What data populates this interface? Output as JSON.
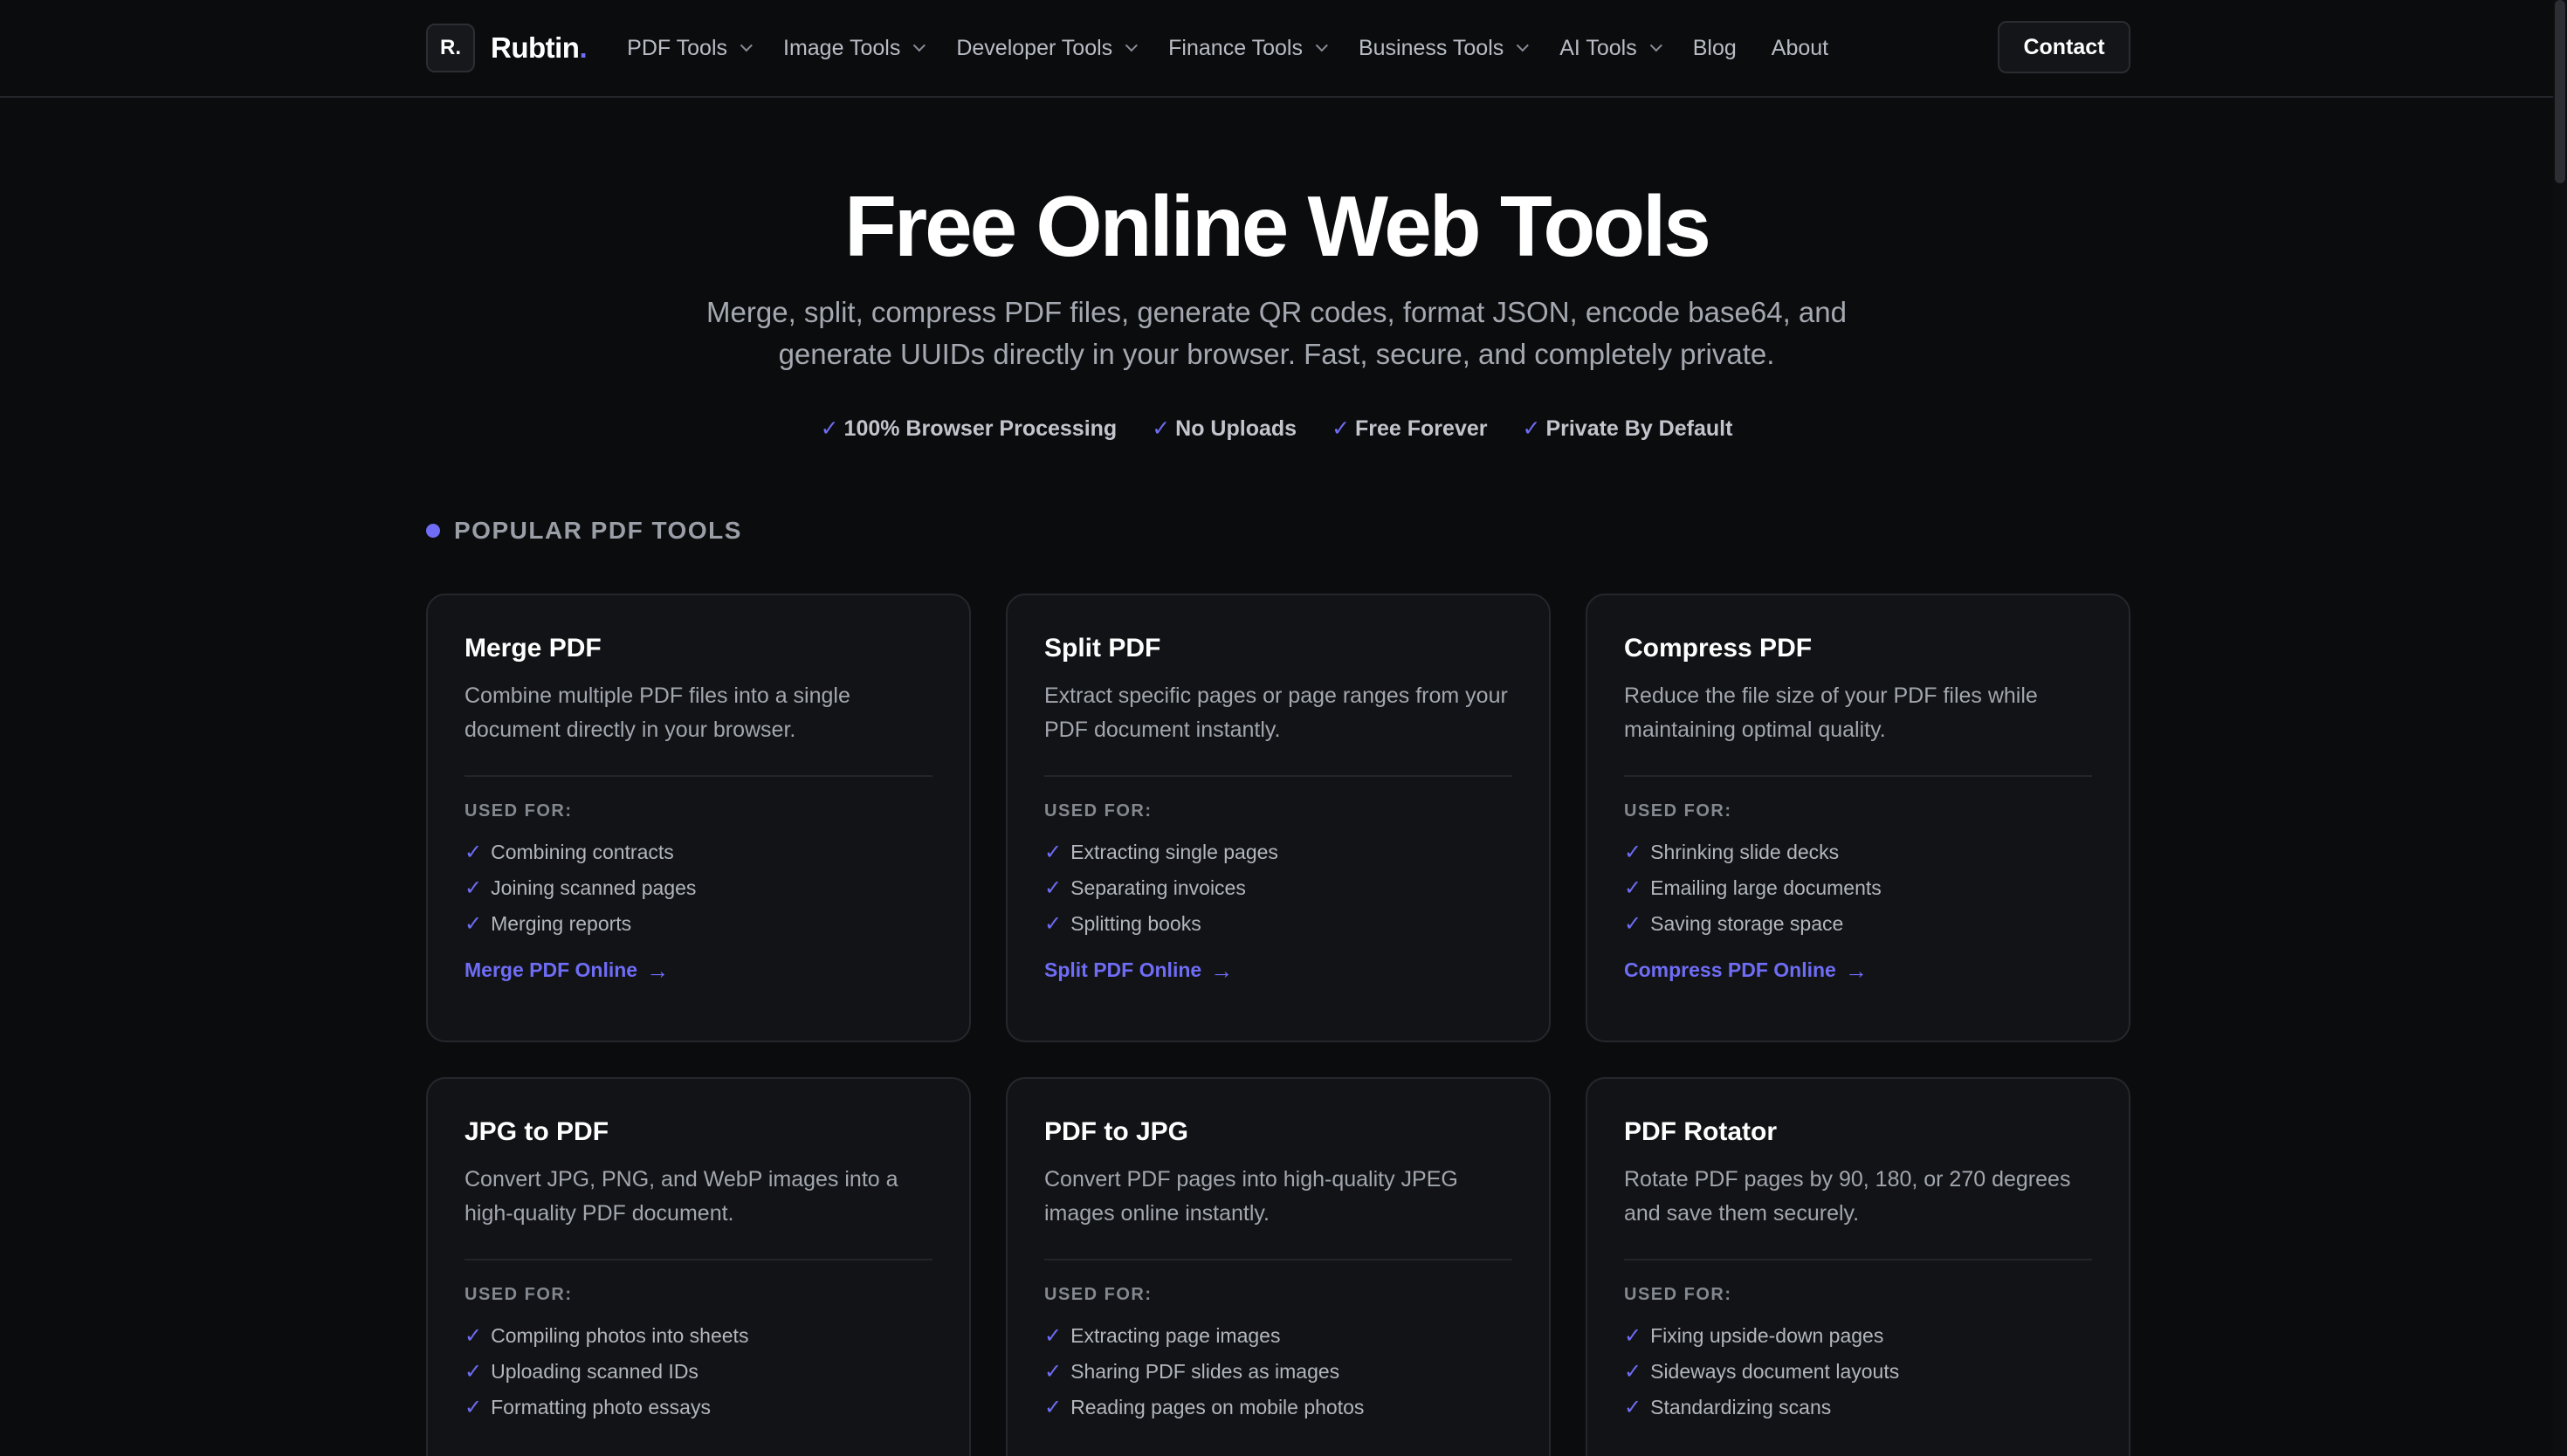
{
  "nav": {
    "logo_mark": "R.",
    "brand": "Rubtin",
    "brand_dot": ".",
    "links": [
      {
        "label": "PDF Tools",
        "dropdown": true
      },
      {
        "label": "Image Tools",
        "dropdown": true
      },
      {
        "label": "Developer Tools",
        "dropdown": true
      },
      {
        "label": "Finance Tools",
        "dropdown": true
      },
      {
        "label": "Business Tools",
        "dropdown": true
      },
      {
        "label": "AI Tools",
        "dropdown": true
      },
      {
        "label": "Blog",
        "dropdown": false
      },
      {
        "label": "About",
        "dropdown": false
      }
    ],
    "contact_label": "Contact"
  },
  "hero": {
    "title": "Free Online Web Tools",
    "subtitle": "Merge, split, compress PDF files, generate QR codes, format JSON, encode base64, and generate UUIDs directly in your browser. Fast, secure, and completely private.",
    "badges": [
      "100% Browser Processing",
      "No Uploads",
      "Free Forever",
      "Private By Default"
    ],
    "check_glyph": "✓"
  },
  "section": {
    "title": "POPULAR PDF TOOLS"
  },
  "cards": [
    {
      "title": "Merge PDF",
      "description": "Combine multiple PDF files into a single document directly in your browser.",
      "used_for_label": "USED FOR:",
      "uses": [
        "Combining contracts",
        "Joining scanned pages",
        "Merging reports"
      ],
      "link": "Merge PDF Online"
    },
    {
      "title": "Split PDF",
      "description": "Extract specific pages or page ranges from your PDF document instantly.",
      "used_for_label": "USED FOR:",
      "uses": [
        "Extracting single pages",
        "Separating invoices",
        "Splitting books"
      ],
      "link": "Split PDF Online"
    },
    {
      "title": "Compress PDF",
      "description": "Reduce the file size of your PDF files while maintaining optimal quality.",
      "used_for_label": "USED FOR:",
      "uses": [
        "Shrinking slide decks",
        "Emailing large documents",
        "Saving storage space"
      ],
      "link": "Compress PDF Online"
    },
    {
      "title": "JPG to PDF",
      "description": "Convert JPG, PNG, and WebP images into a high-quality PDF document.",
      "used_for_label": "USED FOR:",
      "uses": [
        "Compiling photos into sheets",
        "Uploading scanned IDs",
        "Formatting photo essays"
      ],
      "link": ""
    },
    {
      "title": "PDF to JPG",
      "description": "Convert PDF pages into high-quality JPEG images online instantly.",
      "used_for_label": "USED FOR:",
      "uses": [
        "Extracting page images",
        "Sharing PDF slides as images",
        "Reading pages on mobile photos"
      ],
      "link": ""
    },
    {
      "title": "PDF Rotator",
      "description": "Rotate PDF pages by 90, 180, or 270 degrees and save them securely.",
      "used_for_label": "USED FOR:",
      "uses": [
        "Fixing upside-down pages",
        "Sideways document layouts",
        "Standardizing scans"
      ],
      "link": ""
    }
  ],
  "colors": {
    "accent": "#6f6cf5",
    "background": "#0b0c0e",
    "card": "#111316"
  }
}
